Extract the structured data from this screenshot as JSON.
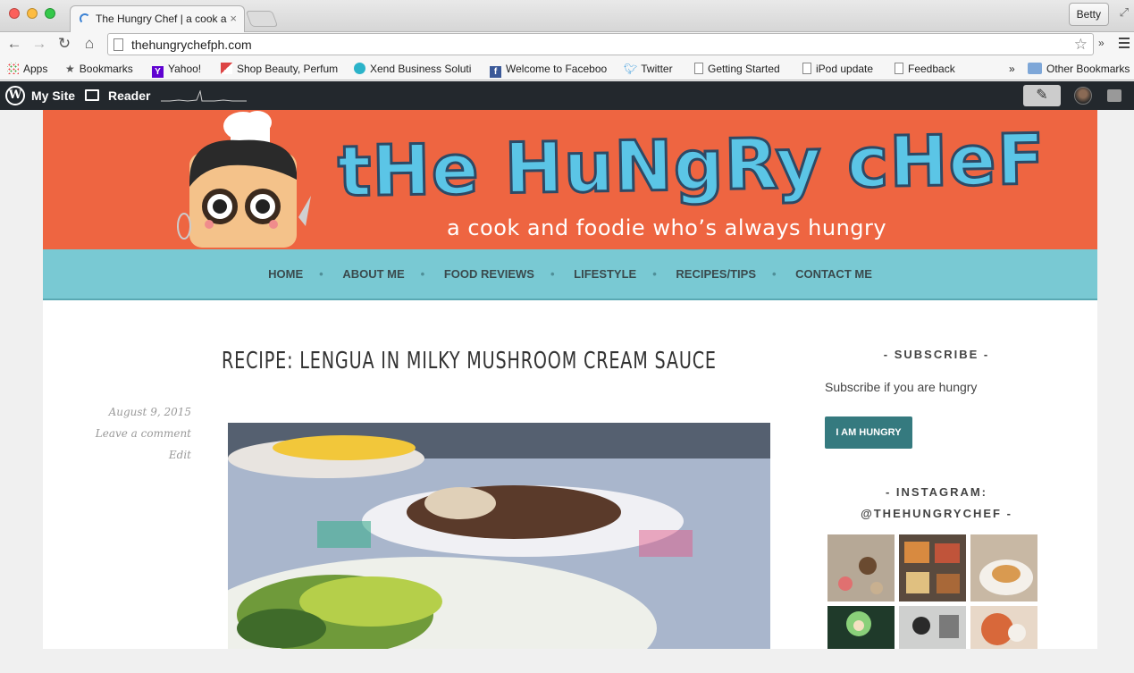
{
  "browser": {
    "tab_title": "The Hungry Chef | a cook a",
    "tab_close": "×",
    "user": "Betty",
    "url": "thehungrychefph.com",
    "bookmarks": [
      {
        "label": "Apps"
      },
      {
        "label": "Bookmarks"
      },
      {
        "label": "Yahoo!"
      },
      {
        "label": "Shop Beauty, Perfum"
      },
      {
        "label": "Xend Business Soluti"
      },
      {
        "label": "Welcome to Faceboo"
      },
      {
        "label": "Twitter"
      },
      {
        "label": "Getting Started"
      },
      {
        "label": "iPod update"
      },
      {
        "label": "Feedback"
      }
    ],
    "bookmarks_overflow": "»",
    "other_bookmarks": "Other Bookmarks",
    "toolbar_overflow": "»"
  },
  "wpbar": {
    "my_site": "My Site",
    "reader": "Reader",
    "wp_logo": "W"
  },
  "header": {
    "title": "tHe HuNgRy cHeF",
    "tagline": "a cook and foodie who’s always hungry"
  },
  "nav": {
    "items": [
      "HOME",
      "ABOUT ME",
      "FOOD REVIEWS",
      "LIFESTYLE",
      "RECIPES/TIPS",
      "CONTACT ME"
    ],
    "separator": "•"
  },
  "post": {
    "title": "RECIPE: LENGUA IN MILKY MUSHROOM CREAM SAUCE",
    "date": "August 9, 2015",
    "comment": "Leave a comment",
    "edit": "Edit"
  },
  "sidebar": {
    "subscribe_title": "- SUBSCRIBE -",
    "subscribe_text": "Subscribe if you are hungry",
    "subscribe_button": "I AM HUNGRY",
    "instagram_title_1": "- INSTAGRAM:",
    "instagram_title_2": "@THEHUNGRYCHEF -"
  },
  "colors": {
    "header_bg": "#ee6541",
    "nav_bg": "#79c9d3",
    "title_blue": "#5bc5e6",
    "button_teal": "#357a7f",
    "wpbar_bg": "#23282d"
  }
}
